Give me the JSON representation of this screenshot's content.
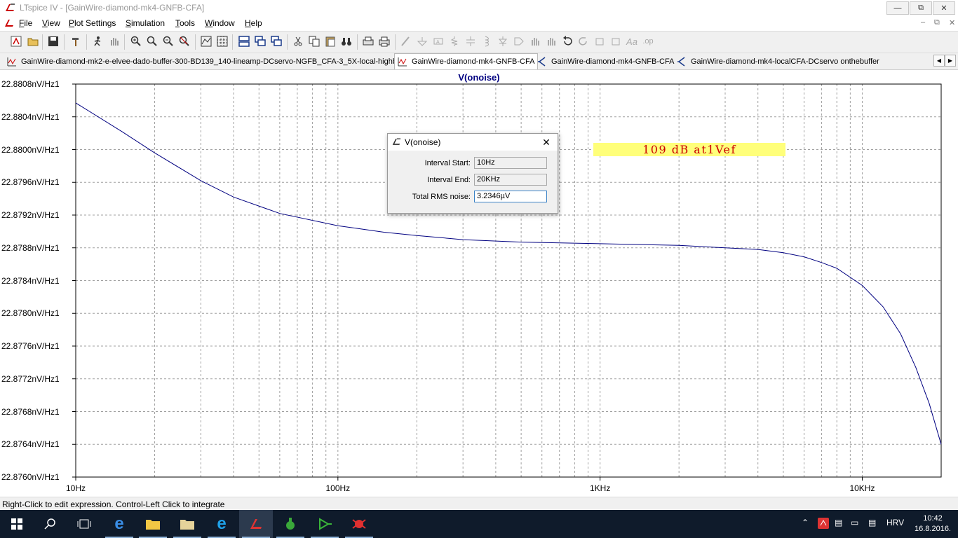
{
  "window": {
    "title": "LTspice IV - [GainWire-diamond-mk4-GNFB-CFA]"
  },
  "menu": {
    "items": [
      {
        "label": "File",
        "key": "F",
        "rest": "ile"
      },
      {
        "label": "View",
        "key": "V",
        "rest": "iew"
      },
      {
        "label": "Plot Settings",
        "key": "P",
        "rest": "lot Settings"
      },
      {
        "label": "Simulation",
        "key": "S",
        "rest": "imulation"
      },
      {
        "label": "Tools",
        "key": "T",
        "rest": "ools"
      },
      {
        "label": "Window",
        "key": "W",
        "rest": "indow"
      },
      {
        "label": "Help",
        "key": "H",
        "rest": "elp"
      }
    ]
  },
  "tabs": [
    {
      "label": "GainWire-diamond-mk2-e-elvee-dado-buffer-300-BD139_140-lineamp-DCservo-NGFB_CFA-3_5X-local-highbias",
      "icon": "waveform-icon",
      "active": false
    },
    {
      "label": "GainWire-diamond-mk4-GNFB-CFA",
      "icon": "waveform-icon",
      "active": true
    },
    {
      "label": "GainWire-diamond-mk4-GNFB-CFA",
      "icon": "schematic-icon",
      "active": false
    },
    {
      "label": "GainWire-diamond-mk4-localCFA-DCservo onthebuffer",
      "icon": "schematic-icon",
      "active": false
    }
  ],
  "plot": {
    "title": "V(onoise)",
    "annotation": "109 dB at1Vef"
  },
  "chart_data": {
    "type": "line",
    "title": "V(onoise)",
    "xscale": "log",
    "xlim": [
      10,
      20000
    ],
    "ylim": [
      22.876,
      22.8808
    ],
    "yunit": "nV/Hz½",
    "x_tick_labels": [
      "10Hz",
      "100Hz",
      "1KHz",
      "10KHz"
    ],
    "y_tick_labels": [
      "22.8808nV/Hz1",
      "22.8804nV/Hz1",
      "22.8800nV/Hz1",
      "22.8796nV/Hz1",
      "22.8792nV/Hz1",
      "22.8788nV/Hz1",
      "22.8784nV/Hz1",
      "22.8780nV/Hz1",
      "22.8776nV/Hz1",
      "22.8772nV/Hz1",
      "22.8768nV/Hz1",
      "22.8764nV/Hz1",
      "22.8760nV/Hz1"
    ],
    "grid": true,
    "series": [
      {
        "name": "V(onoise)",
        "color": "#000080",
        "x": [
          10,
          15,
          20,
          30,
          40,
          60,
          100,
          150,
          200,
          300,
          500,
          1000,
          2000,
          3000,
          4000,
          5000,
          6000,
          7000,
          8000,
          10000,
          12000,
          14000,
          16000,
          18000,
          20000
        ],
        "y": [
          22.88057,
          22.88022,
          22.87996,
          22.87962,
          22.87942,
          22.87922,
          22.87907,
          22.87899,
          22.87895,
          22.8789,
          22.87887,
          22.87885,
          22.87883,
          22.8788,
          22.87878,
          22.87874,
          22.87869,
          22.87862,
          22.87855,
          22.87834,
          22.87808,
          22.87775,
          22.87734,
          22.8769,
          22.8764
        ]
      }
    ]
  },
  "dialog": {
    "title": "V(onoise)",
    "interval_start_label": "Interval Start:",
    "interval_start_value": "10Hz",
    "interval_end_label": "Interval End:",
    "interval_end_value": "20KHz",
    "rms_label": "Total RMS noise:",
    "rms_value": "3.2346µV"
  },
  "status": {
    "text": "Right-Click to edit expression. Control-Left Click to integrate"
  },
  "taskbar": {
    "language": "HRV",
    "time": "10:42",
    "date": "16.8.2016."
  }
}
